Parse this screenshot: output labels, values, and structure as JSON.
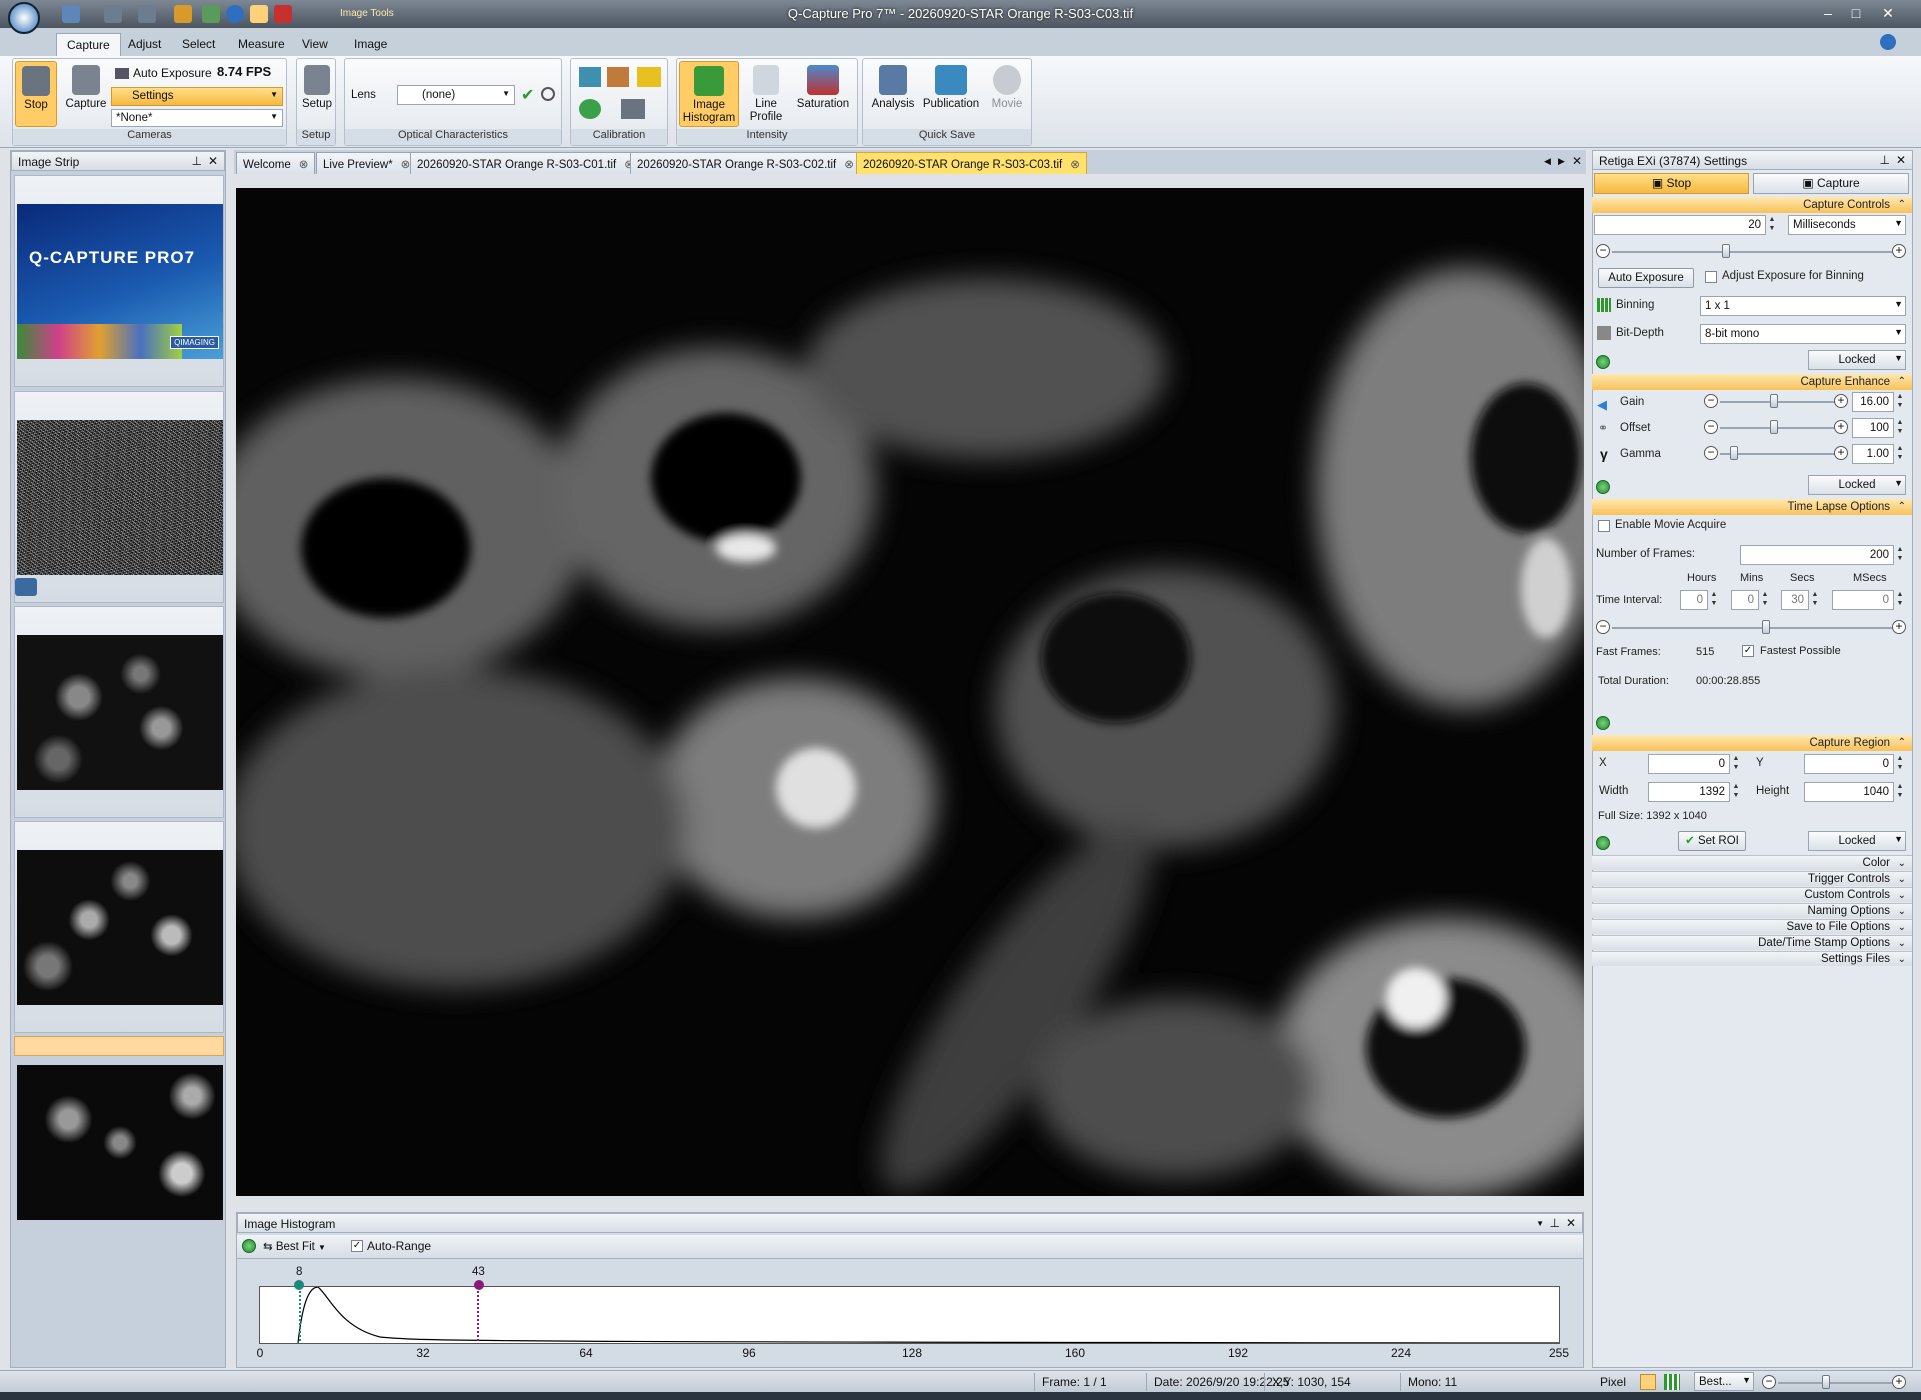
{
  "window": {
    "title": "Q-Capture Pro 7™ - 20260920-STAR Orange R-S03-C03.tif",
    "context_tab": "Image Tools"
  },
  "ribbon": {
    "tabs": [
      "Capture",
      "Adjust",
      "Select",
      "Measure",
      "View",
      "Image"
    ],
    "cameras": {
      "stop": "Stop",
      "capture": "Capture",
      "auto_exposure": "Auto Exposure",
      "fps": "8.74 FPS",
      "settings": "Settings",
      "preset": "*None*",
      "group": "Cameras"
    },
    "setup": {
      "label": "Setup",
      "group": "Setup"
    },
    "optical": {
      "lens_label": "Lens",
      "lens_value": "(none)",
      "group": "Optical Characteristics"
    },
    "calibration": {
      "group": "Calibration"
    },
    "intensity": {
      "histogram": "Image Histogram",
      "line_profile": "Line Profile",
      "saturation": "Saturation",
      "group": "Intensity"
    },
    "quicksave": {
      "analysis": "Analysis",
      "publication": "Publication",
      "movie": "Movie",
      "group": "Quick Save"
    }
  },
  "strip": {
    "title": "Image Strip",
    "splash_text": "Q-CAPTURE PRO7",
    "splash_brand": "QIMAGING"
  },
  "doc_tabs": [
    "Welcome",
    "Live Preview*",
    "20260920-STAR Orange R-S03-C01.tif",
    "20260920-STAR Orange R-S03-C02.tif",
    "20260920-STAR Orange R-S03-C03.tif"
  ],
  "histogram": {
    "title": "Image Histogram",
    "fit": "Best Fit",
    "auto_range": "Auto-Range",
    "low_marker": "8",
    "high_marker": "43",
    "ticks": [
      "0",
      "32",
      "64",
      "96",
      "128",
      "160",
      "192",
      "224",
      "255"
    ],
    "colors": {
      "low": "#1a8a7a",
      "high": "#8a1a7a"
    }
  },
  "settings": {
    "title": "Retiga EXi (37874) Settings",
    "stop": "Stop",
    "capture": "Capture",
    "capture_controls": {
      "title": "Capture Controls",
      "exposure": "20",
      "unit": "Milliseconds",
      "auto_exposure": "Auto Exposure",
      "adjust_binning": "Adjust Exposure for Binning",
      "binning_label": "Binning",
      "binning": "1 x 1",
      "bitdepth_label": "Bit-Depth",
      "bitdepth": "8-bit mono",
      "locked": "Locked"
    },
    "capture_enhance": {
      "title": "Capture Enhance",
      "gain_label": "Gain",
      "gain": "16.00",
      "offset_label": "Offset",
      "offset": "100",
      "gamma_label": "Gamma",
      "gamma": "1.00",
      "locked": "Locked"
    },
    "time_lapse": {
      "title": "Time Lapse Options",
      "enable": "Enable Movie Acquire",
      "frames_label": "Number of Frames:",
      "frames": "200",
      "hours": "Hours",
      "mins": "Mins",
      "secs": "Secs",
      "msecs": "MSecs",
      "interval_label": "Time Interval:",
      "h": "0",
      "m": "0",
      "s": "30",
      "ms": "0",
      "fast_label": "Fast Frames:",
      "fast": "515",
      "fastest": "Fastest Possible",
      "duration_label": "Total Duration:",
      "duration": "00:00:28.855"
    },
    "capture_region": {
      "title": "Capture Region",
      "x_label": "X",
      "x": "0",
      "y_label": "Y",
      "y": "0",
      "w_label": "Width",
      "w": "1392",
      "h_label": "Height",
      "h": "1040",
      "full": "Full Size: 1392 x 1040",
      "set_roi": "Set ROI",
      "locked": "Locked"
    },
    "collapsed": [
      "Color",
      "Trigger Controls",
      "Custom Controls",
      "Naming Options",
      "Save to File Options",
      "Date/Time Stamp Options",
      "Settings Files"
    ]
  },
  "status": {
    "frame": "Frame: 1 / 1",
    "date": "Date: 2026/9/20 19:22:25",
    "xy": "X,Y: 1030,  154",
    "mono": "Mono:   11",
    "pixel": "Pixel",
    "zoom": "Best..."
  }
}
